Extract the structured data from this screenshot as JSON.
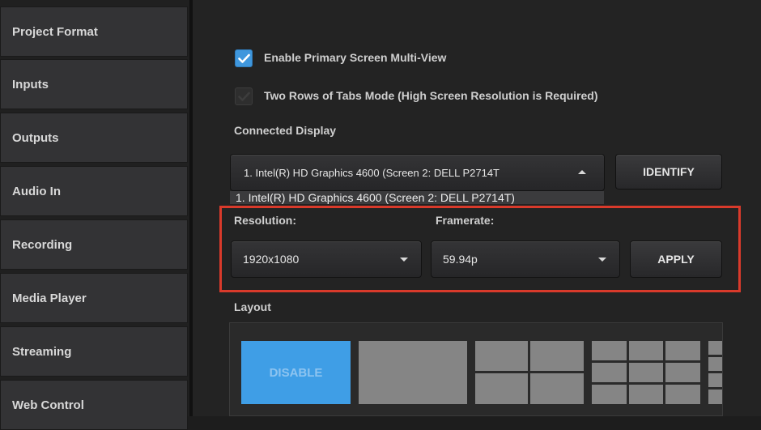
{
  "sidebar": {
    "items": [
      {
        "label": "Project Format"
      },
      {
        "label": "Inputs"
      },
      {
        "label": "Outputs"
      },
      {
        "label": "Audio In"
      },
      {
        "label": "Recording"
      },
      {
        "label": "Media Player"
      },
      {
        "label": "Streaming"
      },
      {
        "label": "Web Control"
      }
    ]
  },
  "multiview": {
    "enable_label": "Enable Primary Screen Multi-View",
    "enable_checked": true,
    "two_rows_label": "Two Rows of Tabs Mode (High Screen Resolution is Required)",
    "two_rows_checked": false
  },
  "display": {
    "label": "Connected Display",
    "selected": "1. Intel(R) HD Graphics 4600 (Screen 2: DELL P2714T",
    "option": "1. Intel(R) HD Graphics 4600 (Screen 2: DELL P2714T)",
    "identify_label": "IDENTIFY"
  },
  "resolution": {
    "label": "Resolution:",
    "value": "1920x1080"
  },
  "framerate": {
    "label": "Framerate:",
    "value": "59.94p"
  },
  "apply_label": "APPLY",
  "layout": {
    "label": "Layout",
    "disable_label": "DISABLE"
  },
  "colors": {
    "accent": "#3f97dd",
    "highlight": "#d93a2b"
  }
}
